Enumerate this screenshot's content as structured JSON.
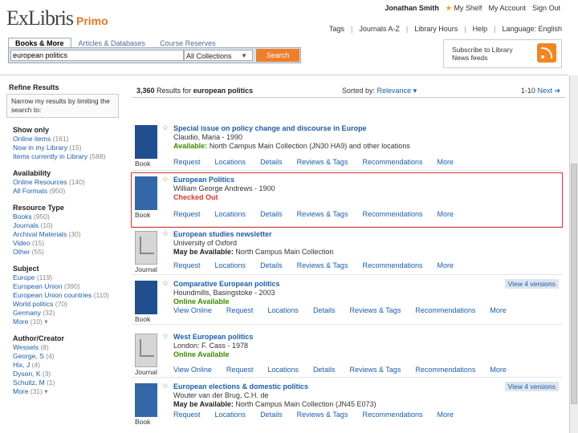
{
  "header": {
    "logo_main": "ExLibris",
    "logo_sub": "Primo",
    "user_name": "Jonathan Smith",
    "my_shelf": "My Shelf",
    "my_account": "My Account",
    "sign_out": "Sign Out",
    "nav": [
      "Tags",
      "Journals A-Z",
      "Library Hours",
      "Help",
      "Language: English"
    ]
  },
  "search": {
    "tabs": [
      "Books & More",
      "Articles & Databases",
      "Course Reserves"
    ],
    "query": "european politics",
    "scope": "All Collections",
    "button_label": "Search"
  },
  "subscribe": {
    "text": "Subscribe to Library News feeds"
  },
  "sidebar": {
    "title": "Refine Results",
    "hint": "Narrow my results by limiting the search to:",
    "facets": [
      {
        "title": "Show only",
        "items": [
          {
            "label": "Online items",
            "count": "(161)"
          },
          {
            "label": "Now in my Library",
            "count": "(15)"
          },
          {
            "label": "Items currently in Library",
            "count": "(588)"
          }
        ]
      },
      {
        "title": "Availability",
        "items": [
          {
            "label": "Online Resources",
            "count": "(140)"
          },
          {
            "label": "All Formats",
            "count": "(950)"
          }
        ]
      },
      {
        "title": "Resource Type",
        "items": [
          {
            "label": "Books",
            "count": "(950)"
          },
          {
            "label": "Journals",
            "count": "(10)"
          },
          {
            "label": "Archival Materials",
            "count": "(30)"
          },
          {
            "label": "Video",
            "count": "(15)"
          },
          {
            "label": "Other",
            "count": "(55)"
          }
        ]
      },
      {
        "title": "Subject",
        "items": [
          {
            "label": "Europe",
            "count": "(119)"
          },
          {
            "label": "European Union",
            "count": "(390)"
          },
          {
            "label": "European Union countries",
            "count": "(110)"
          },
          {
            "label": "World politics",
            "count": "(70)"
          },
          {
            "label": "Germany",
            "count": "(32)"
          },
          {
            "label": "More",
            "count": "(10) ▾"
          }
        ]
      },
      {
        "title": "Author/Creator",
        "items": [
          {
            "label": "Wessels",
            "count": "(8)"
          },
          {
            "label": "George, S",
            "count": "(4)"
          },
          {
            "label": "Hix, J",
            "count": "(4)"
          },
          {
            "label": "Dyson, K",
            "count": "(3)"
          },
          {
            "label": "Schultz, M",
            "count": "(1)"
          },
          {
            "label": "More",
            "count": "(31) ▾"
          }
        ]
      }
    ]
  },
  "results_header": {
    "count": "3,360",
    "count_text": "Results for",
    "query": "european politics",
    "sorted_label": "Sorted by:",
    "sorted_value": "Relevance ▾",
    "pager": "1-10",
    "next": "Next ➔"
  },
  "results": [
    {
      "type": "Book",
      "title": "Special issue on policy change and discourse in Europe",
      "sub": "Claudio, Maria - 1990",
      "avail_status": "Available:",
      "avail_rest": "North Campus Main Collection (JN30 HA9) and other locations",
      "status_class": "green",
      "actions": [
        "Request",
        "Locations",
        "Details",
        "Reviews & Tags",
        "Recommendations",
        "More"
      ]
    },
    {
      "type": "Book",
      "title": "European Politics",
      "sub": "William George Andrews - 1900",
      "avail_status": "Checked Out",
      "avail_rest": "",
      "status_class": "red",
      "actions": [
        "Request",
        "Locations",
        "Details",
        "Reviews & Tags",
        "Recommendations",
        "More"
      ]
    },
    {
      "type": "Journal",
      "title": "European studies newsletter",
      "sub": "University of Oxford",
      "avail_status": "May be Available:",
      "avail_rest": "North Campus Main Collection",
      "status_class": "maybe",
      "actions": [
        "Request",
        "Locations",
        "Details",
        "Reviews & Tags",
        "Recommendations",
        "More"
      ]
    },
    {
      "type": "Book",
      "title": "Comparative European politics",
      "sub": "Houndmills, Basingstoke - 2003",
      "avail_status": "Online Available",
      "avail_rest": "",
      "status_class": "green",
      "versions": "View 4 versions",
      "actions": [
        "View Online",
        "Request",
        "Locations",
        "Details",
        "Reviews & Tags",
        "Recommendations",
        "More"
      ]
    },
    {
      "type": "Journal",
      "title": "West European politics",
      "sub": "London: F. Cass - 1978",
      "avail_status": "Online Available",
      "avail_rest": "",
      "status_class": "green",
      "actions": [
        "View Online",
        "Request",
        "Locations",
        "Details",
        "Reviews & Tags",
        "Recommendations",
        "More"
      ]
    },
    {
      "type": "Book",
      "title": "European elections & domestic politics",
      "sub": "Wouter van der Brug, C.H. de",
      "avail_status": "May be Available:",
      "avail_rest": "North Campus Main Collection (JN45 E073)",
      "status_class": "maybe",
      "versions": "View 4 versions",
      "actions": [
        "Request",
        "Locations",
        "Details",
        "Reviews & Tags",
        "Recommendations",
        "More"
      ]
    }
  ]
}
